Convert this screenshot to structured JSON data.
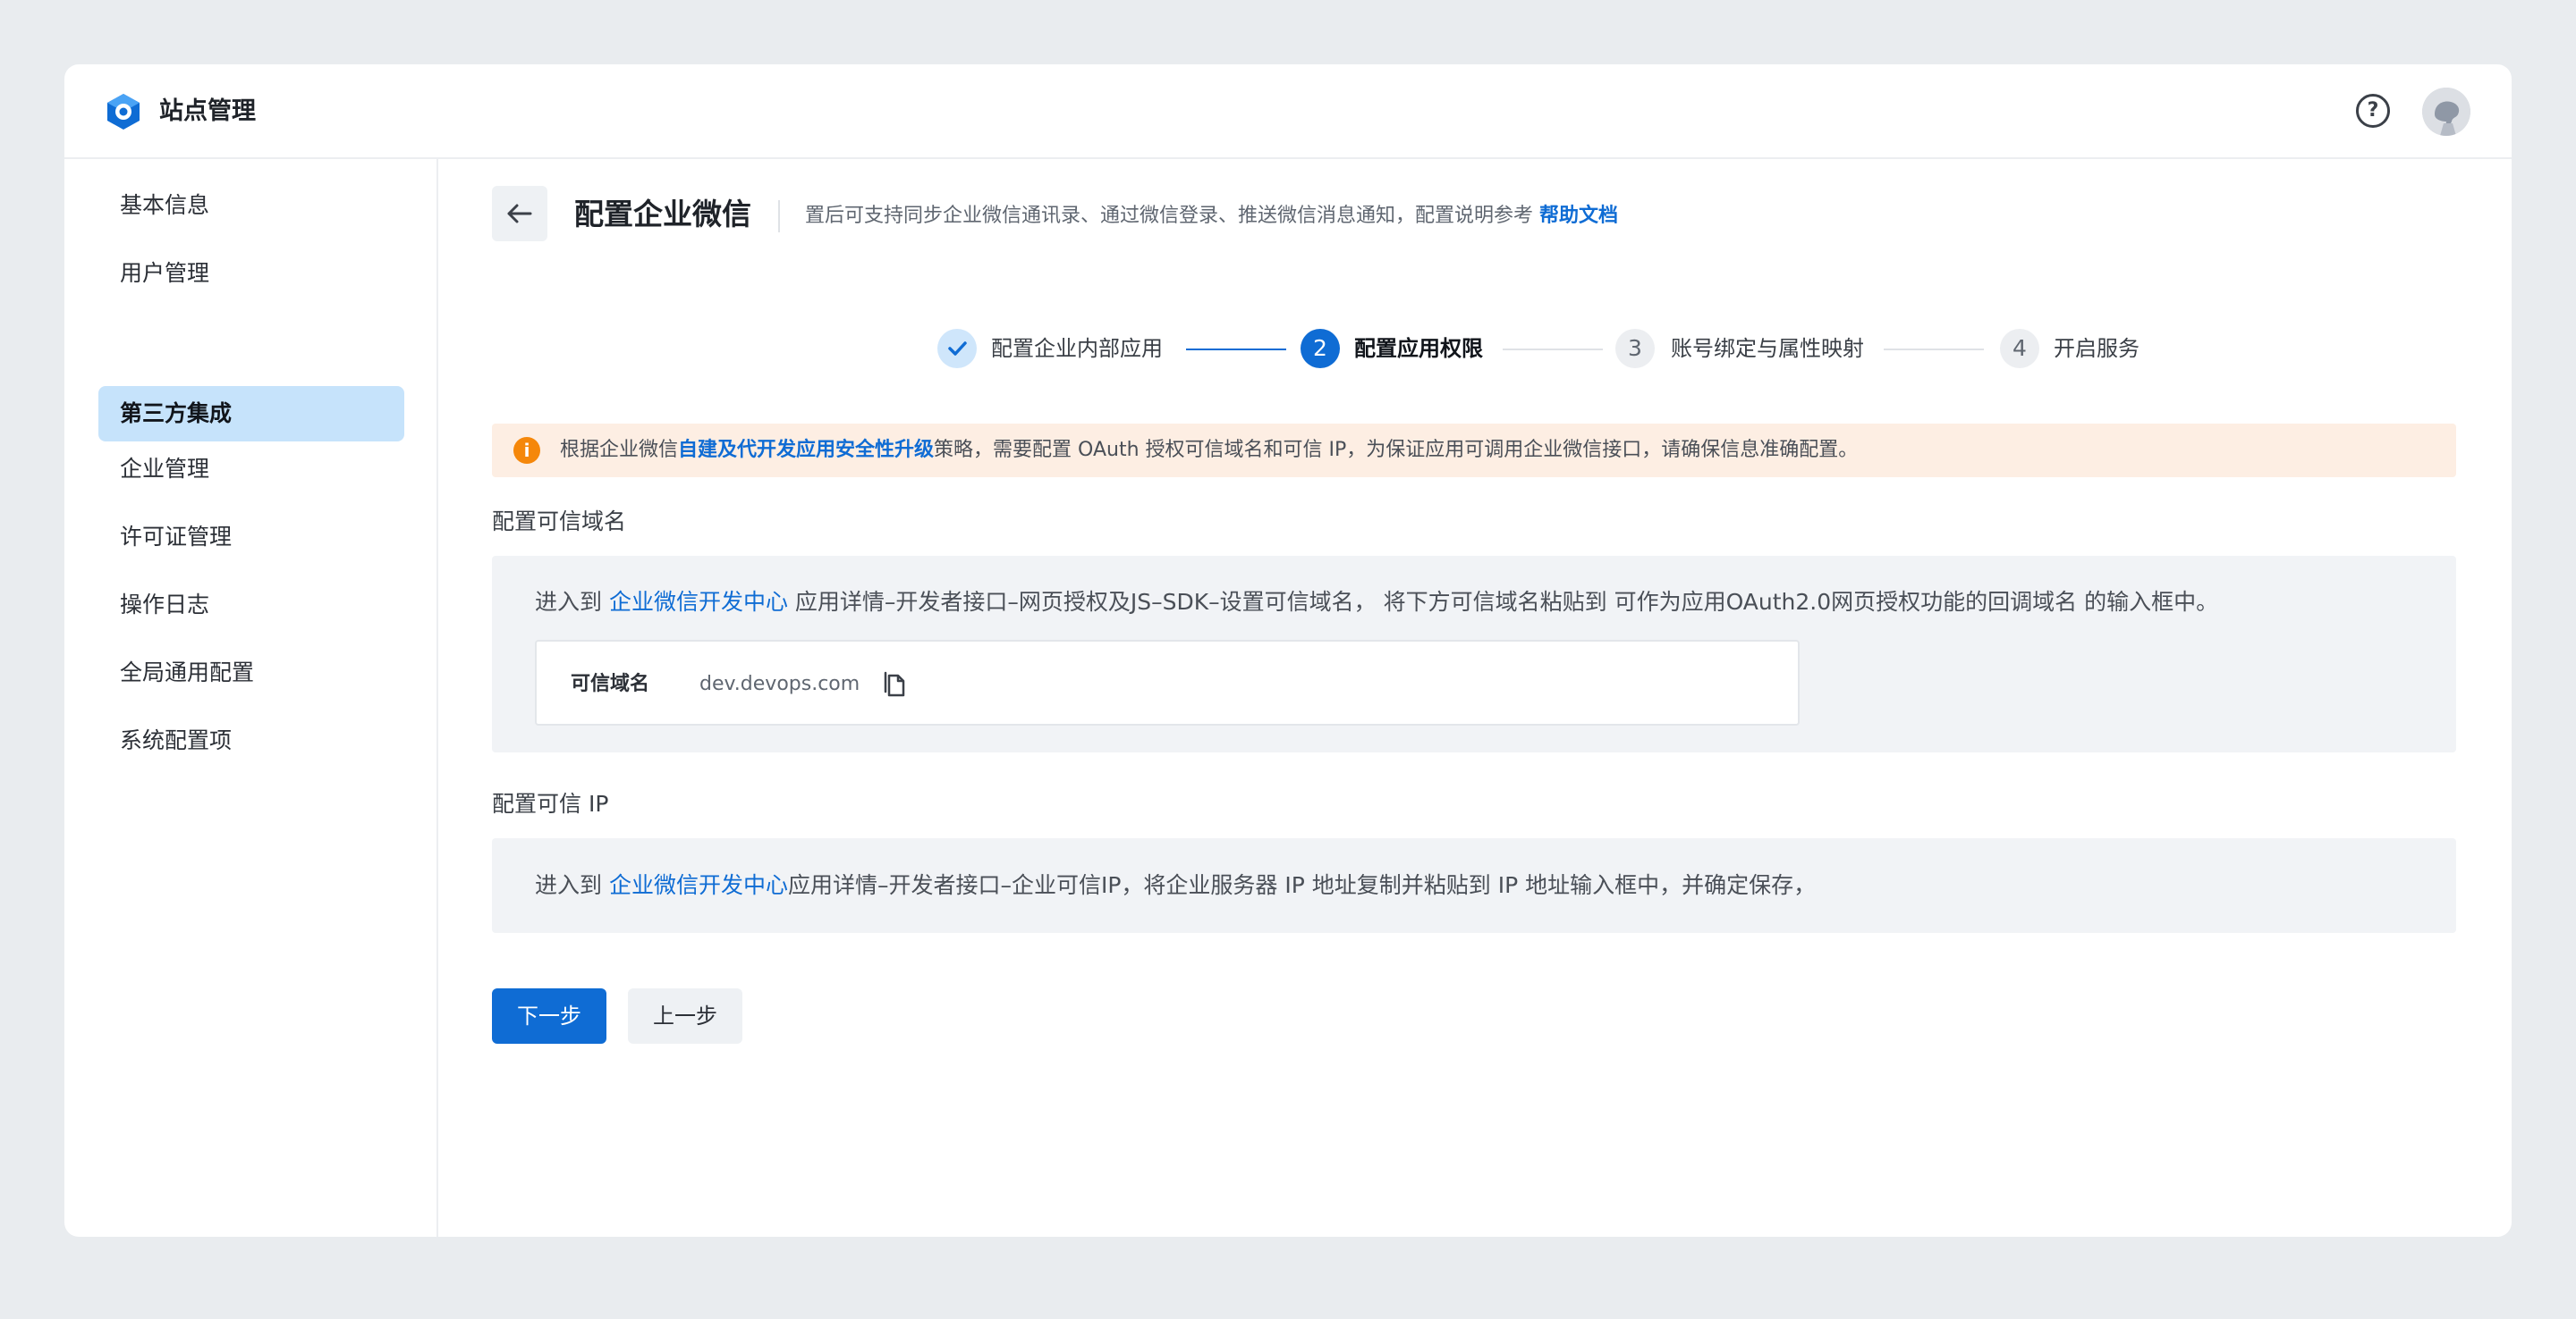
{
  "app": {
    "title": "站点管理",
    "logo_icon": "hexagon-logo-icon",
    "help_icon": "question-circle-icon",
    "avatar_icon": "user-avatar"
  },
  "sidebar": {
    "items": [
      {
        "label": "基本信息",
        "active": false
      },
      {
        "label": "用户管理",
        "active": false
      },
      {
        "label": "第三方集成",
        "active": true
      },
      {
        "label": "企业管理",
        "active": false
      },
      {
        "label": "许可证管理",
        "active": false
      },
      {
        "label": "操作日志",
        "active": false
      },
      {
        "label": "全局通用配置",
        "active": false
      },
      {
        "label": "系统配置项",
        "active": false
      }
    ]
  },
  "header": {
    "back_icon": "arrow-left-icon",
    "title": "配置企业微信",
    "description": "置后可支持同步企业微信通讯录、通过微信登录、推送微信消息通知，配置说明参考",
    "help_link": "帮助文档"
  },
  "steps": [
    {
      "label": "配置企业内部应用",
      "state": "done",
      "number": ""
    },
    {
      "label": "配置应用权限",
      "state": "active",
      "number": "2"
    },
    {
      "label": "账号绑定与属性映射",
      "state": "todo",
      "number": "3"
    },
    {
      "label": "开启服务",
      "state": "todo",
      "number": "4"
    }
  ],
  "alert": {
    "icon": "info-circle-icon",
    "prefix": "根据企业微信",
    "link": "自建及代开发应用安全性升级",
    "suffix": "策略，需要配置 OAuth 授权可信域名和可信 IP，为保证应用可调用企业微信接口，请确保信息准确配置。"
  },
  "domain_section": {
    "label": "配置可信域名",
    "text_prefix": "进入到 ",
    "link": "企业微信开发中心",
    "text_suffix": " 应用详情–开发者接口–网页授权及JS–SDK–设置可信域名， 将下方可信域名粘贴到 可作为应用OAuth2.0网页授权功能的回调域名 的输入框中。",
    "field_label": "可信域名",
    "field_value": "dev.devops.com",
    "copy_icon": "copy-icon"
  },
  "ip_section": {
    "label": "配置可信 IP",
    "text_prefix": "进入到 ",
    "link": "企业微信开发中心",
    "text_suffix": "应用详情–开发者接口–企业可信IP，将企业服务器 IP 地址复制并粘贴到 IP 地址输入框中，并确定保存，"
  },
  "actions": {
    "next": "下一步",
    "prev": "上一步"
  },
  "colors": {
    "primary": "#0f6cd4",
    "active_nav_bg": "#c6e3fb",
    "alert_bg": "#fdeee3",
    "alert_icon": "#f5870a",
    "panel_bg": "#f1f3f6"
  }
}
